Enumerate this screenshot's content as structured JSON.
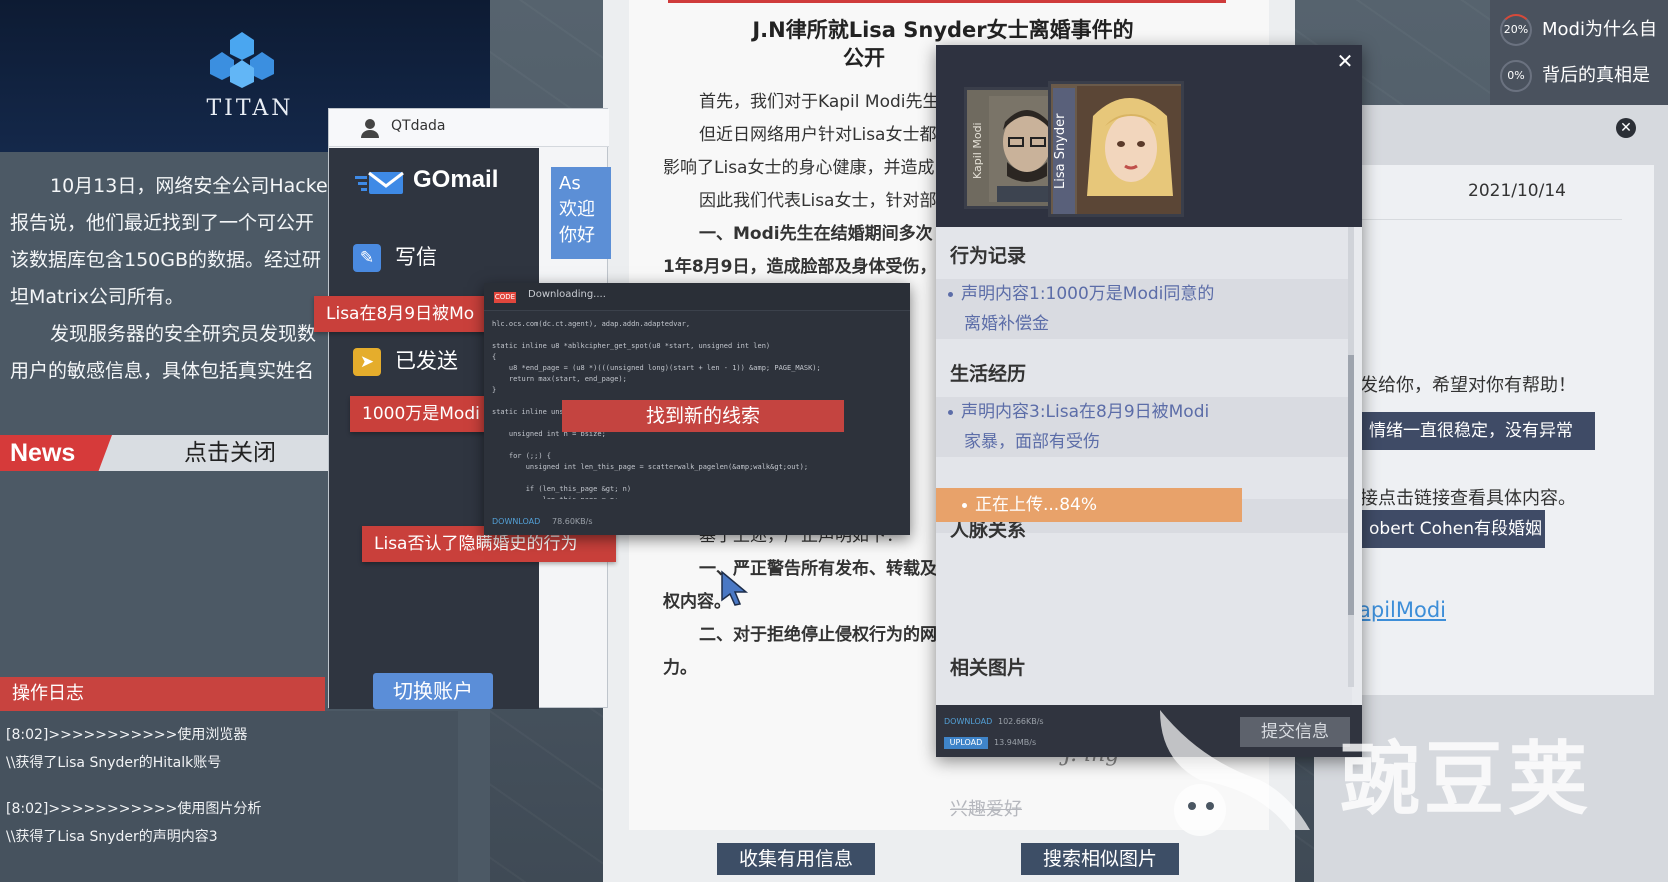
{
  "news": {
    "logo_text": "TITAN",
    "lines": [
      "10月13日，网络安全公司Hacke",
      "报告说，他们最近找到了一个可公开",
      "该数据库包含150GB的数据。经过研",
      "坦Matrix公司所有。",
      "发现服务器的安全研究员发现数",
      "用户的敏感信息，具体包括真实姓名"
    ],
    "tag": "News",
    "close_label": "点击关闭"
  },
  "oplog": {
    "title": "操作日志",
    "entries": [
      "[8:02]>>>>>>>>>>>使用浏览器",
      "\\\\获得了Lisa Snyder的Hitalk账号",
      "[8:02]>>>>>>>>>>>使用图片分析",
      "\\\\获得了Lisa Snyder的声明内容3"
    ]
  },
  "gomail": {
    "username": "QTdada",
    "app_name": "GOmail",
    "compose": "写信",
    "sent": "已发送",
    "switch_account": "切换账户",
    "mail_preview": [
      "As",
      "欢迎",
      "你好"
    ]
  },
  "clues": {
    "c1": "Lisa在8月9日被Mo",
    "c2": "1000万是Modi",
    "c3": "Lisa否认了隐瞒婚史的行为"
  },
  "document": {
    "title_line1": "J.N律所就Lisa Snyder女士离婚事件的",
    "title_line2": "公开",
    "paragraphs": [
      "首先，我们对于Kapil Modi先生",
      "但近日网络用户针对Lisa女士都",
      "影响了Lisa女士的身心健康，并造成",
      "因此我们代表Lisa女士，针对部",
      "一、Modi先生在结婚期间多次",
      "1年8月9日，造成脸部及身体受伤，"
    ],
    "lower": [
      "基于上述，严正声明如下：",
      "一、严正警告所有发布、转载及评论",
      "权内容。",
      "二、对于拒绝停止侵权行为的网",
      "力。"
    ],
    "signature": "J. ing",
    "collect_button": "收集有用信息",
    "search_button": "搜索相似图片"
  },
  "terminal": {
    "tag": "CODE",
    "status": "Downloading....",
    "code": "hlc.ocs.com(dc.ct.agent), adap.addn.adaptedvar,\n\nstatic inline u8 *ablkcipher_get_spot(u8 *start, unsigned int len)\n{\n    u8 *end_page = (u8 *)(((unsigned long)(start + len - 1)) &amp; PAGE_MASK);\n    return max(start, end_page);\n}\n\nstatic inline unsigned int ablkcipher_done_slow(struct ablkcipher_walk *walk,\n\n    unsigned int n = bsize;\n\n    for (;;) {\n        unsigned int len_this_page = scatterwalk_pagelen(&amp;walk&gt;out);\n\n        if (len_this_page &gt; n)\n            len_this_page = n;\n        scatterwalk",
    "found_label": "找到新的线索",
    "footer_label": "DOWNLOAD",
    "footer_rate": "78.60KB/s"
  },
  "profile": {
    "card_modi": "Kapil Modi",
    "card_lisa": "Lisa Snyder",
    "sec_behavior": "行为记录",
    "behavior_item_1": "声明内容1:1000万是Modi同意的",
    "behavior_item_2": "离婚补偿金",
    "sec_life": "生活经历",
    "life_item_1": "声明内容3:Lisa在8月9日被Modi",
    "life_item_2": "家暴，面部有受伤",
    "uploading": "正在上传...84%",
    "upload_progress": 84,
    "sec_relations": "人脉关系",
    "hobby": "兴趣爱好",
    "sec_images": "相关图片",
    "download_label": "DOWNLOAD",
    "download_rate": "102.66KB/s",
    "upload_label": "UPLOAD",
    "upload_rate": "13.94MB/s",
    "submit": "提交信息"
  },
  "chat": {
    "date": "2021/10/14",
    "line1": "发给你，希望对你有帮助！",
    "bubble1": "情绪一直很稳定，没有异常",
    "line2": "接点击链接查看具体内容。",
    "bubble2": "obert Cohen有段婚姻",
    "link": "apilModi"
  },
  "trending": [
    {
      "ring": "20%",
      "text": "Modi为什么自"
    },
    {
      "ring": "0%",
      "text": "背后的真相是"
    }
  ],
  "watermark": "豌豆荚",
  "colors": {
    "accent_red": "#c9403b",
    "upload_orange": "#e8a26a",
    "mail_blue": "#5b8ed8",
    "link_blue": "#3d8ed8"
  }
}
